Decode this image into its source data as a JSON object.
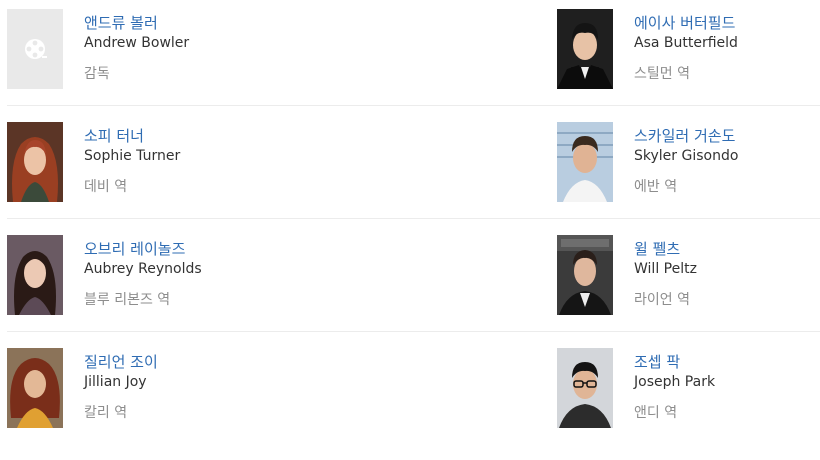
{
  "cast": [
    {
      "name_ko": "앤드류 볼러",
      "name_en": "Andrew Bowler",
      "role": "감독",
      "photo": "placeholder-film-icon",
      "bg": "#e9e9e9"
    },
    {
      "name_ko": "에이사 버터필드",
      "name_en": "Asa Butterfield",
      "role": "스틸먼 역",
      "photo": "portrait",
      "bg": "#2a2a2a"
    },
    {
      "name_ko": "소피 터너",
      "name_en": "Sophie Turner",
      "role": "데비 역",
      "photo": "portrait",
      "bg": "#6b3a2a"
    },
    {
      "name_ko": "스카일러 거손도",
      "name_en": "Skyler Gisondo",
      "role": "에반 역",
      "photo": "portrait",
      "bg": "#a9bfd4"
    },
    {
      "name_ko": "오브리 레이놀즈",
      "name_en": "Aubrey Reynolds",
      "role": "블루 리본즈 역",
      "photo": "portrait",
      "bg": "#5a4a55"
    },
    {
      "name_ko": "윌 펠츠",
      "name_en": "Will Peltz",
      "role": "라이언 역",
      "photo": "portrait",
      "bg": "#3a3a3a"
    },
    {
      "name_ko": "질리언 조이",
      "name_en": "Jillian Joy",
      "role": "칼리 역",
      "photo": "portrait",
      "bg": "#8a6a4a"
    },
    {
      "name_ko": "조셉 팍",
      "name_en": "Joseph Park",
      "role": "앤디 역",
      "photo": "portrait",
      "bg": "#cfd2d6"
    }
  ]
}
